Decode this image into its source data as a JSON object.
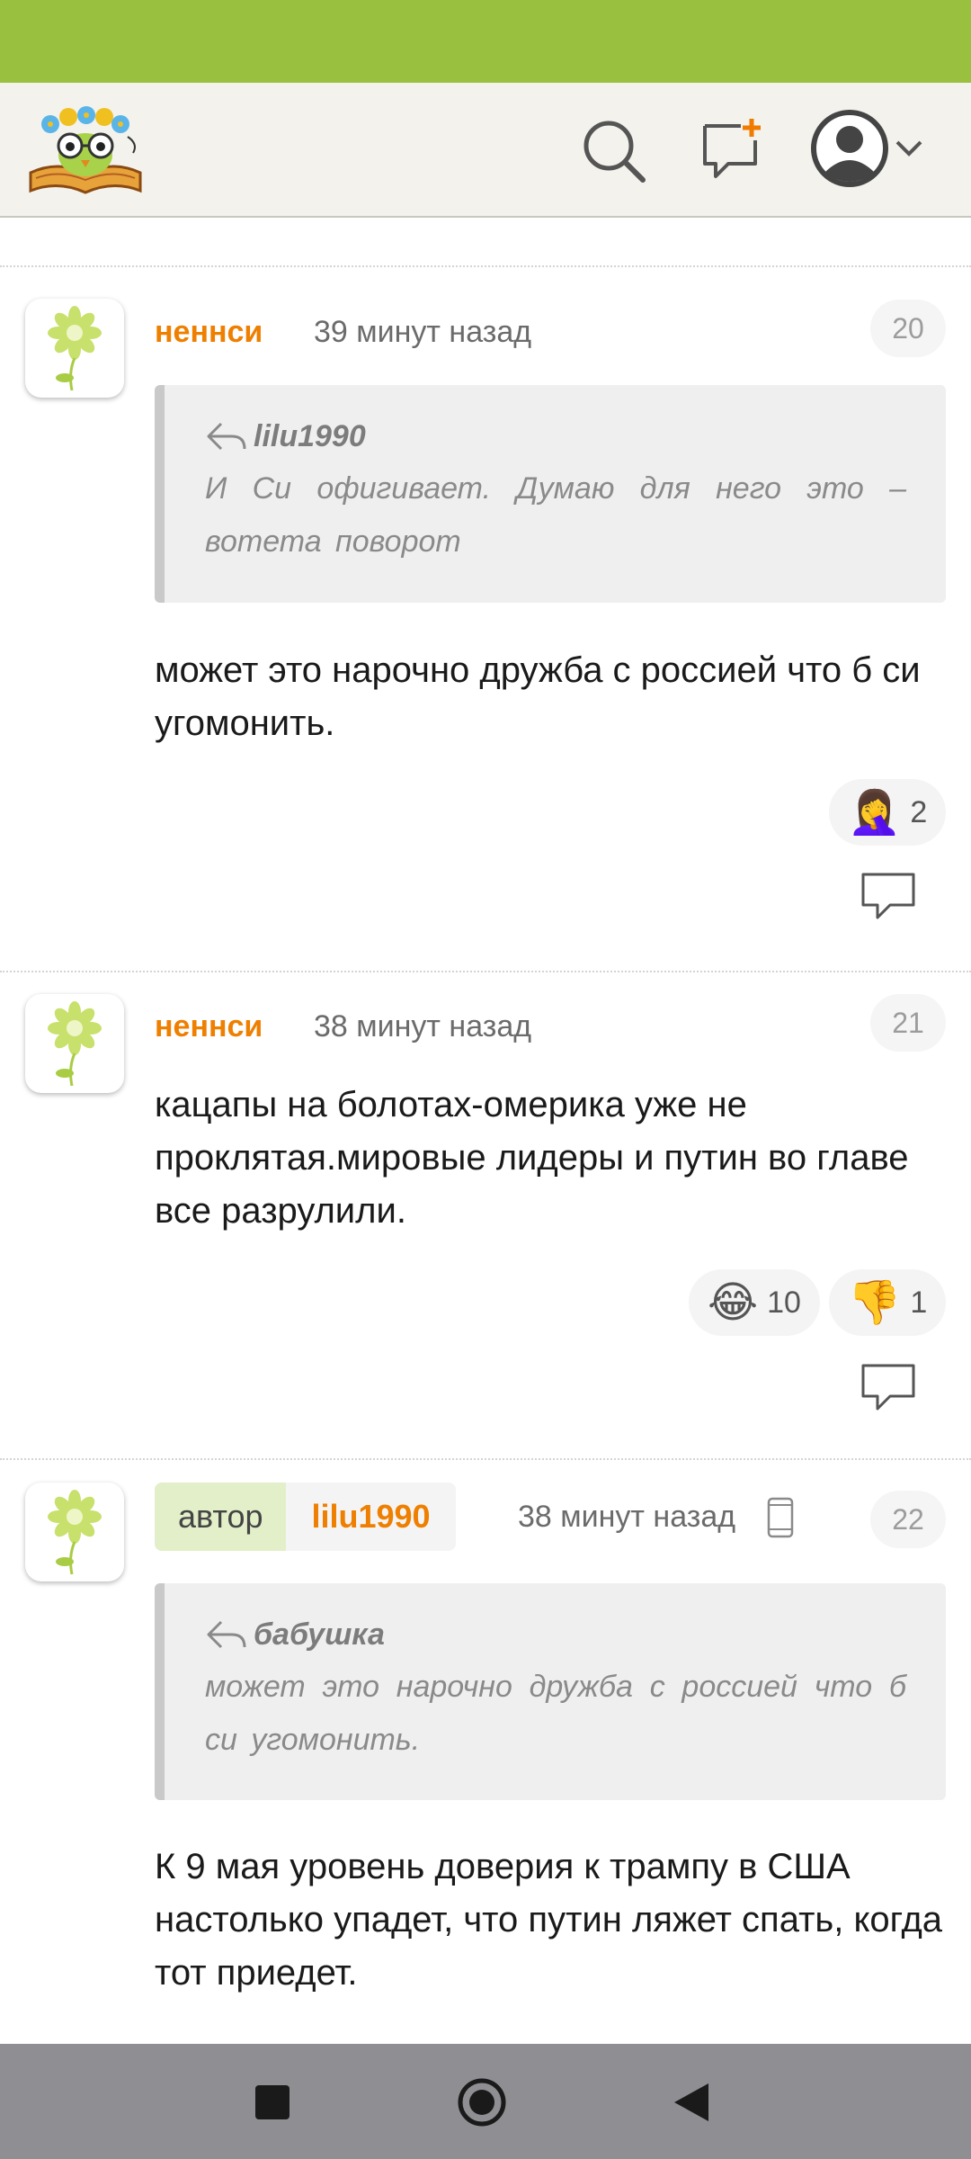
{
  "header": {
    "logo_icon": "owl-book-logo",
    "search_icon": "search-icon",
    "new_message_icon": "new-message-icon",
    "profile_icon": "profile-avatar-icon",
    "menu_icon": "chevron-down-icon"
  },
  "comments": [
    {
      "author": "неннси",
      "time": "39 минут назад",
      "number": "20",
      "quote": {
        "author": "lilu1990",
        "text": "И Си офигивает. Думаю для него это – вотета поворот"
      },
      "text": "может это нарочно дружба с россией что б си угомонить.",
      "reactions": [
        {
          "emoji": "🤦‍♀️",
          "count": "2"
        }
      ]
    },
    {
      "author": "неннси",
      "time": "38 минут назад",
      "number": "21",
      "text": "кацапы на болотах-омерика уже не проклятая.мировые лидеры и путин во главе все разрулили.",
      "reactions": [
        {
          "emoji": "😂",
          "count": "10"
        },
        {
          "emoji": "👎",
          "count": "1"
        }
      ]
    },
    {
      "author_tag": "автор",
      "author": "lilu1990",
      "time": "38 минут назад",
      "number": "22",
      "device_icon": "mobile-phone-icon",
      "quote": {
        "author": "бабушка",
        "text": "может это нарочно дружба с россией что б си угомонить."
      },
      "text": "К 9 мая уровень доверия к трампу в США настолько упадет, что путин ляжет спать, когда тот приедет."
    }
  ],
  "colors": {
    "status_bar": "#9ac03f",
    "header_bg": "#f3f2ec",
    "author_name": "#ee7f00",
    "author_tag_bg": "#e2efc8",
    "nav_bar": "#8e8e93"
  },
  "navigation": {
    "recent_icon": "square-recents-icon",
    "home_icon": "circle-home-icon",
    "back_icon": "triangle-back-icon"
  }
}
